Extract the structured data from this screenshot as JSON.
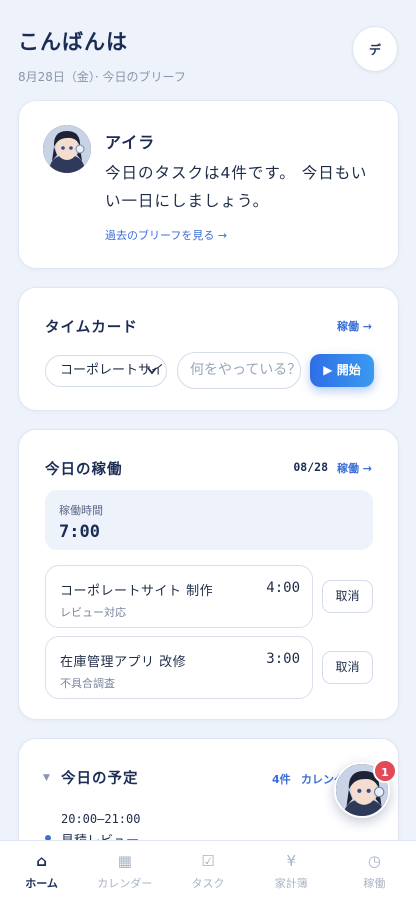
{
  "header": {
    "greeting": "こんばんは",
    "subtitle": "8月28日（金）· 今日のブリーフ",
    "avatar_label": "デ"
  },
  "brief": {
    "name": "アイラ",
    "message": "今日のタスクは4件です。 今日もいい一日にしましょう。",
    "past_link": "過去のブリーフを見る →"
  },
  "timecard": {
    "title": "タイムカード",
    "link": "稼働 →",
    "select_value": "コーポレートサイト",
    "input_placeholder": "何をやっている？",
    "start_label": "▶ 開始"
  },
  "work": {
    "title": "今日の稼働",
    "date": "08/28",
    "link": "稼働 →",
    "total_label": "稼働時間",
    "total_value": "7:00",
    "entries": [
      {
        "name": "コーポレートサイト 制作",
        "time": "4:00",
        "note": "レビュー対応",
        "cancel": "取消"
      },
      {
        "name": "在庫管理アプリ 改修",
        "time": "3:00",
        "note": "不具合調査",
        "cancel": "取消"
      }
    ]
  },
  "schedule": {
    "title": "今日の予定",
    "count": "4件",
    "calendar_link": "カレンダー →",
    "items": [
      {
        "time": "20:00–21:00",
        "name": "見積レビュー"
      }
    ]
  },
  "assistant": {
    "badge": "1"
  },
  "nav": [
    {
      "label": "ホーム",
      "icon": "⌂",
      "active": true
    },
    {
      "label": "カレンダー",
      "icon": "▦",
      "active": false
    },
    {
      "label": "タスク",
      "icon": "☑",
      "active": false
    },
    {
      "label": "家計簿",
      "icon": "¥",
      "active": false
    },
    {
      "label": "稼働",
      "icon": "◷",
      "active": false
    }
  ]
}
